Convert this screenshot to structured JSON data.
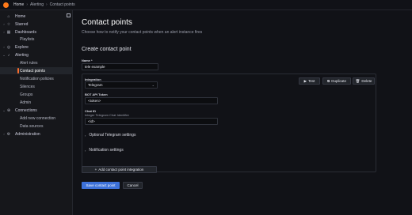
{
  "breadcrumb": {
    "home": "Home",
    "sep": "›",
    "section": "Alerting",
    "current": "Contact points"
  },
  "sidebar": {
    "items": [
      {
        "label": "Home",
        "icon": "⌂",
        "chev": ""
      },
      {
        "label": "Starred",
        "icon": "☆",
        "chev": "›"
      },
      {
        "label": "Dashboards",
        "icon": "▦",
        "chev": "›"
      },
      {
        "label": "Playlists",
        "icon": "",
        "chev": "",
        "sub": true
      },
      {
        "label": "Explore",
        "icon": "◎",
        "chev": "›"
      },
      {
        "label": "Alerting",
        "icon": "♪",
        "chev": "⌄"
      },
      {
        "label": "Alert rules",
        "sub": true
      },
      {
        "label": "Contact points",
        "sub": true,
        "active": true
      },
      {
        "label": "Notification policies",
        "sub": true
      },
      {
        "label": "Silences",
        "sub": true
      },
      {
        "label": "Groups",
        "sub": true
      },
      {
        "label": "Admin",
        "sub": true
      },
      {
        "label": "Connections",
        "icon": "⊕",
        "chev": "⌄"
      },
      {
        "label": "Add new connection",
        "sub": true
      },
      {
        "label": "Data sources",
        "sub": true
      },
      {
        "label": "Administration",
        "icon": "⚙",
        "chev": "›"
      }
    ]
  },
  "page": {
    "title": "Contact points",
    "subtitle": "Choose how to notify your contact points when an alert instance fires",
    "section": "Create contact point"
  },
  "form": {
    "name_label": "Name *",
    "name_value": "tele example",
    "integration_label": "Integration",
    "integration_value": "Telegram",
    "bot_label": "BOT API Token",
    "bot_value": "<token>",
    "chat_label": "Chat ID",
    "chat_desc": "Integer Telegram Chat Identifier",
    "chat_value": "<id>",
    "optional_label": "Optional Telegram settings",
    "notification_label": "Notification settings"
  },
  "actions": {
    "test": "Test",
    "duplicate": "Duplicate",
    "delete": "Delete",
    "add_integration": "Add contact point integration",
    "save": "Save contact point",
    "cancel": "Cancel"
  }
}
